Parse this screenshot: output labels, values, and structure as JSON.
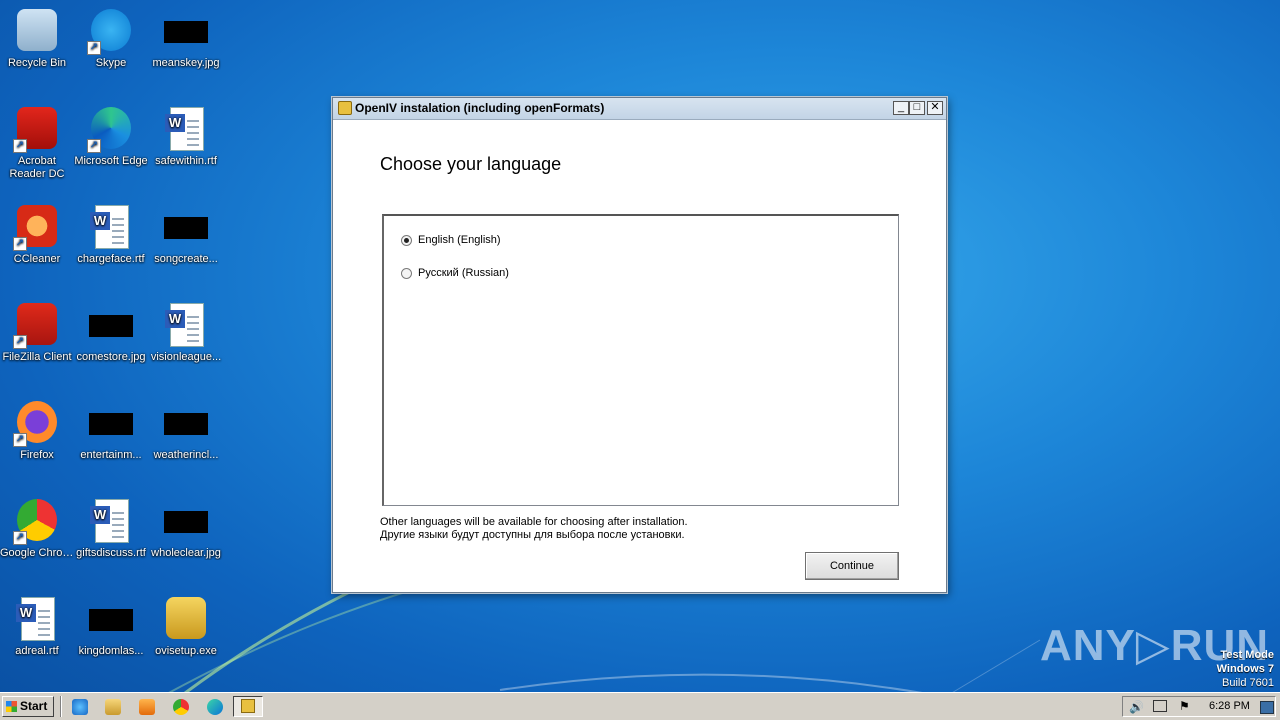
{
  "desktop": {
    "icons": [
      {
        "label": "Recycle Bin",
        "icon": "recycle-bin-icon"
      },
      {
        "label": "Skype",
        "icon": "skype-icon"
      },
      {
        "label": "meanskey.jpg",
        "icon": "image-file-icon"
      },
      {
        "label": "Acrobat Reader DC",
        "icon": "acrobat-icon"
      },
      {
        "label": "Microsoft Edge",
        "icon": "edge-icon"
      },
      {
        "label": "safewithin.rtf",
        "icon": "word-doc-icon"
      },
      {
        "label": "CCleaner",
        "icon": "ccleaner-icon"
      },
      {
        "label": "chargeface.rtf",
        "icon": "word-doc-icon"
      },
      {
        "label": "songcreate...",
        "icon": "image-file-icon"
      },
      {
        "label": "FileZilla Client",
        "icon": "filezilla-icon"
      },
      {
        "label": "comestore.jpg",
        "icon": "image-file-icon"
      },
      {
        "label": "visionleague...",
        "icon": "word-doc-icon"
      },
      {
        "label": "Firefox",
        "icon": "firefox-icon"
      },
      {
        "label": "entertainm...",
        "icon": "image-file-icon"
      },
      {
        "label": "weatherincl...",
        "icon": "image-file-icon"
      },
      {
        "label": "Google Chrome",
        "icon": "chrome-icon"
      },
      {
        "label": "giftsdiscuss.rtf",
        "icon": "word-doc-icon"
      },
      {
        "label": "wholeclear.jpg",
        "icon": "image-file-icon"
      },
      {
        "label": "adreal.rtf",
        "icon": "word-doc-icon"
      },
      {
        "label": "kingdomlas...",
        "icon": "image-file-icon"
      },
      {
        "label": "ovisetup.exe",
        "icon": "installer-icon"
      }
    ]
  },
  "dialog": {
    "title": "OpenIV instalation (including openFormats)",
    "minimize": "_",
    "maximize": "□",
    "close": "✕",
    "heading": "Choose your language",
    "options": [
      {
        "label": "English (English)",
        "selected": true
      },
      {
        "label": "Русский (Russian)",
        "selected": false
      }
    ],
    "note_en": "Other languages will be available for choosing after installation.",
    "note_ru": "Другие языки будут доступны для выбора после установки.",
    "continue_label": "Continue"
  },
  "taskbar": {
    "start_label": "Start",
    "quicklaunch": [
      "ie-icon",
      "explorer-icon",
      "media-player-icon",
      "chrome-icon",
      "edge-icon",
      "installer-task-icon"
    ],
    "clock": "6:28 PM"
  },
  "watermark": {
    "brand": "ANY▷RUN",
    "line1": "Test Mode",
    "line2": "Windows 7",
    "line3": "Build 7601"
  }
}
